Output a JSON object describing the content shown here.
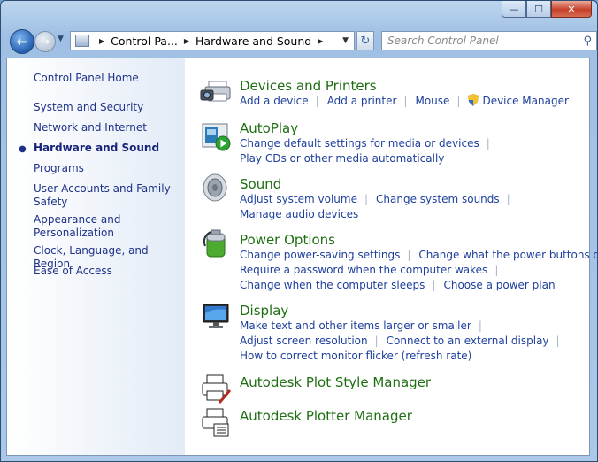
{
  "window": {
    "caption_buttons": {
      "minimize": "—",
      "maximize": "☐",
      "close": "✕"
    }
  },
  "nav": {
    "back_icon": "back-arrow-icon",
    "forward_icon": "forward-arrow-icon",
    "address_segments": [
      "Control Pa...",
      "Hardware and Sound"
    ],
    "search_placeholder": "Search Control Panel"
  },
  "sidebar": {
    "home": "Control Panel Home",
    "items": [
      "System and Security",
      "Network and Internet",
      "Hardware and Sound",
      "Programs",
      "User Accounts and Family Safety",
      "Appearance and Personalization",
      "Clock, Language, and Region",
      "Ease of Access"
    ],
    "current": "Hardware and Sound"
  },
  "categories": [
    {
      "title": "Devices and Printers",
      "icon": "printer-camera-icon",
      "lines": [
        [
          "Add a device",
          "Add a printer",
          "Mouse",
          "Device Manager"
        ]
      ]
    },
    {
      "title": "AutoPlay",
      "icon": "autoplay-icon",
      "lines": [
        [
          "Change default settings for media or devices"
        ],
        [
          "Play CDs or other media automatically"
        ]
      ]
    },
    {
      "title": "Sound",
      "icon": "speaker-icon",
      "lines": [
        [
          "Adjust system volume",
          "Change system sounds"
        ],
        [
          "Manage audio devices"
        ]
      ]
    },
    {
      "title": "Power Options",
      "icon": "battery-icon",
      "lines": [
        [
          "Change power-saving settings",
          "Change what the power buttons do"
        ],
        [
          "Require a password when the computer wakes"
        ],
        [
          "Change when the computer sleeps",
          "Choose a power plan"
        ]
      ]
    },
    {
      "title": "Display",
      "icon": "monitor-icon",
      "lines": [
        [
          "Make text and other items larger or smaller"
        ],
        [
          "Adjust screen resolution",
          "Connect to an external display"
        ],
        [
          "How to correct monitor flicker (refresh rate)"
        ]
      ]
    },
    {
      "title": "Autodesk Plot Style Manager",
      "icon": "plot-style-icon",
      "lines": []
    },
    {
      "title": "Autodesk Plotter Manager",
      "icon": "plotter-icon",
      "lines": []
    }
  ]
}
